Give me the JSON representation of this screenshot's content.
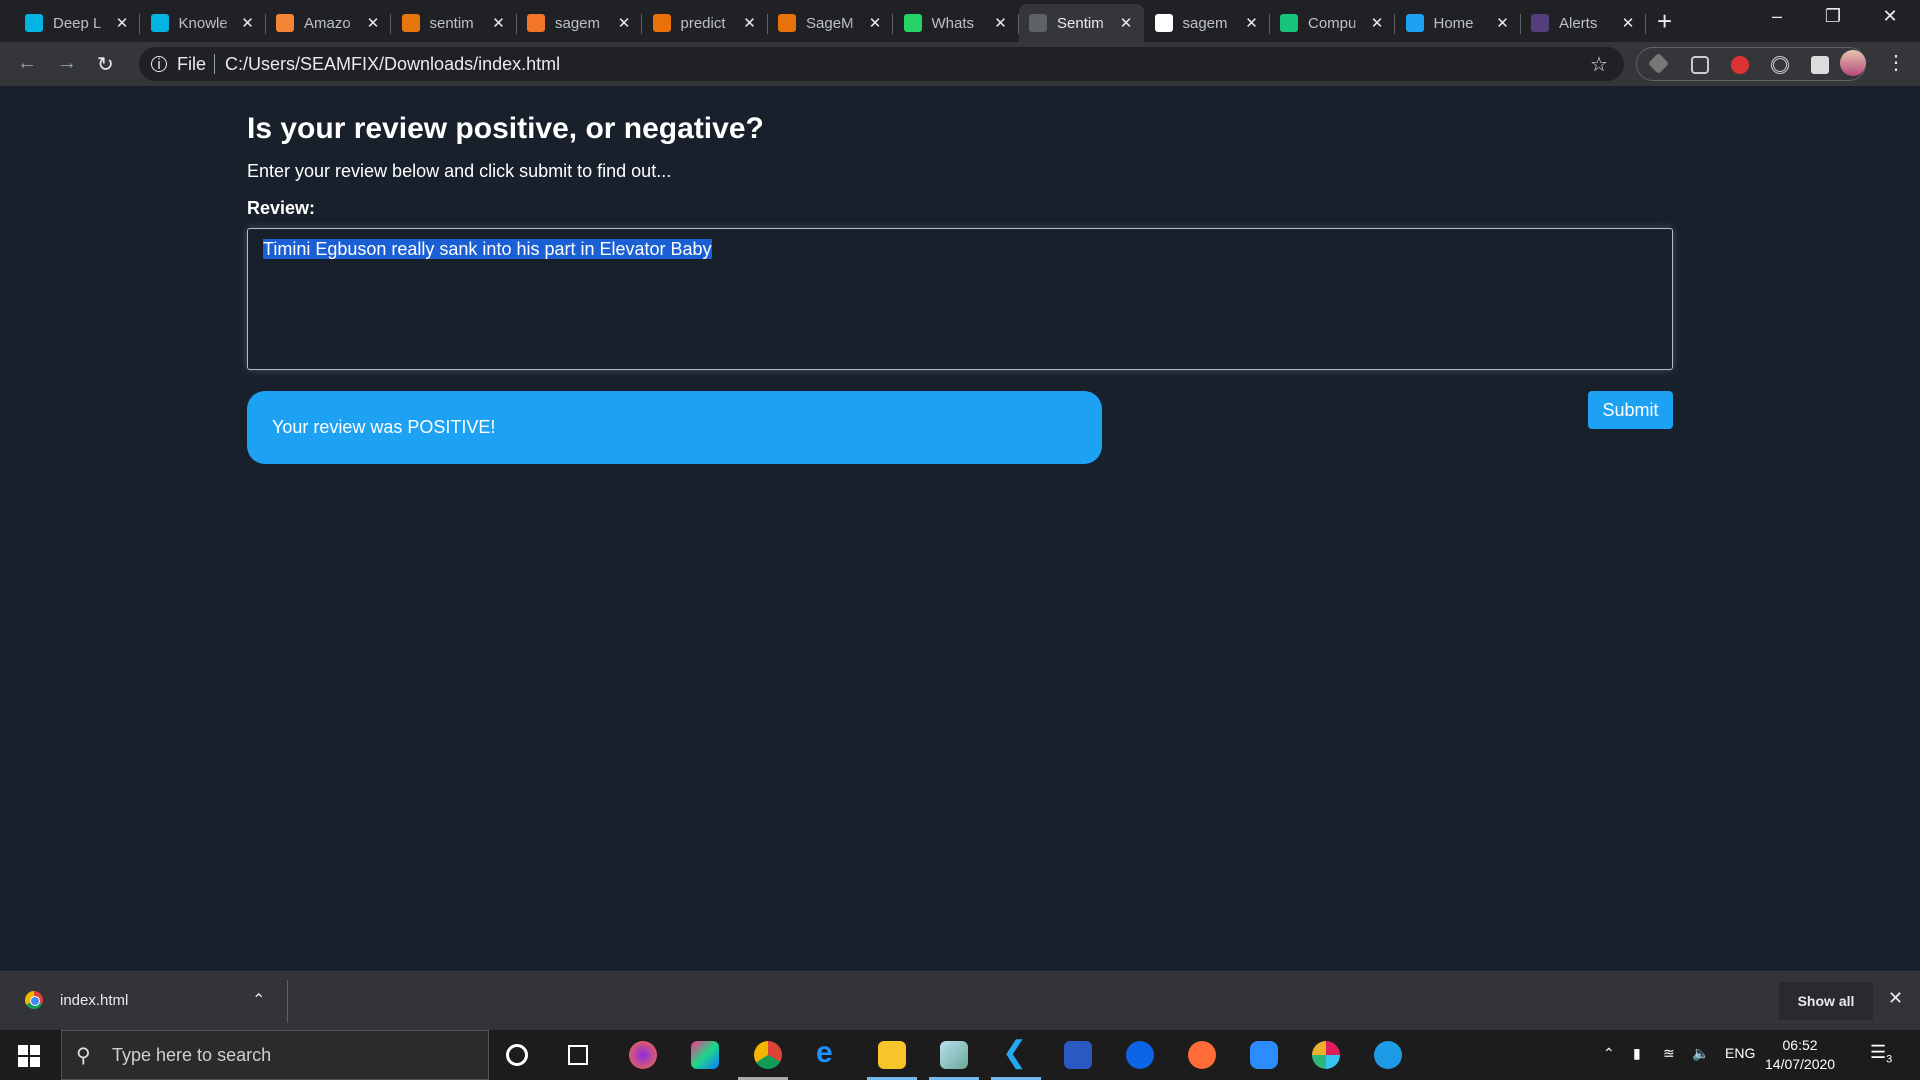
{
  "browser": {
    "tabs": [
      {
        "title": "Deep L",
        "icon": "udacity-icon",
        "color": "#02b3e4"
      },
      {
        "title": "Knowle",
        "icon": "udacity-icon",
        "color": "#02b3e4"
      },
      {
        "title": "Amazo",
        "icon": "aws-box-icon",
        "color": "#f58536"
      },
      {
        "title": "sentim",
        "icon": "aws-lambda-icon",
        "color": "#e7760d"
      },
      {
        "title": "sagem",
        "icon": "jupyter-icon",
        "color": "#f37626"
      },
      {
        "title": "predict",
        "icon": "file-icon",
        "color": "#e8710a"
      },
      {
        "title": "SageM",
        "icon": "book-icon",
        "color": "#e8710a"
      },
      {
        "title": "Whats",
        "icon": "whatsapp-icon",
        "color": "#25d366"
      },
      {
        "title": "Sentim",
        "icon": "globe-icon",
        "color": "#5f6368",
        "active": true
      },
      {
        "title": "sagem",
        "icon": "github-icon",
        "color": "#ffffff"
      },
      {
        "title": "Compu",
        "icon": "dev-icon",
        "color": "#18c47c"
      },
      {
        "title": "Home",
        "icon": "twitter-icon",
        "color": "#1da1f2"
      },
      {
        "title": "Alerts",
        "icon": "bootstrap-icon",
        "color": "#563d7c"
      }
    ],
    "address": {
      "scheme_label": "File",
      "url": "C:/Users/SEAMFIX/Downloads/index.html"
    }
  },
  "page": {
    "title": "Is your review positive, or negative?",
    "subtitle": "Enter your review below and click submit to find out...",
    "review_label": "Review:",
    "review_value": "Timini Egbuson really sank into his part in Elevator Baby",
    "result": "Your review was POSITIVE!",
    "submit_label": "Submit",
    "accent": "#1da1f2"
  },
  "downloads": {
    "file": "index.html",
    "show_all": "Show all"
  },
  "taskbar": {
    "search_placeholder": "Type here to search",
    "language": "ENG",
    "time": "06:52",
    "date": "14/07/2020",
    "notifications": "3"
  }
}
